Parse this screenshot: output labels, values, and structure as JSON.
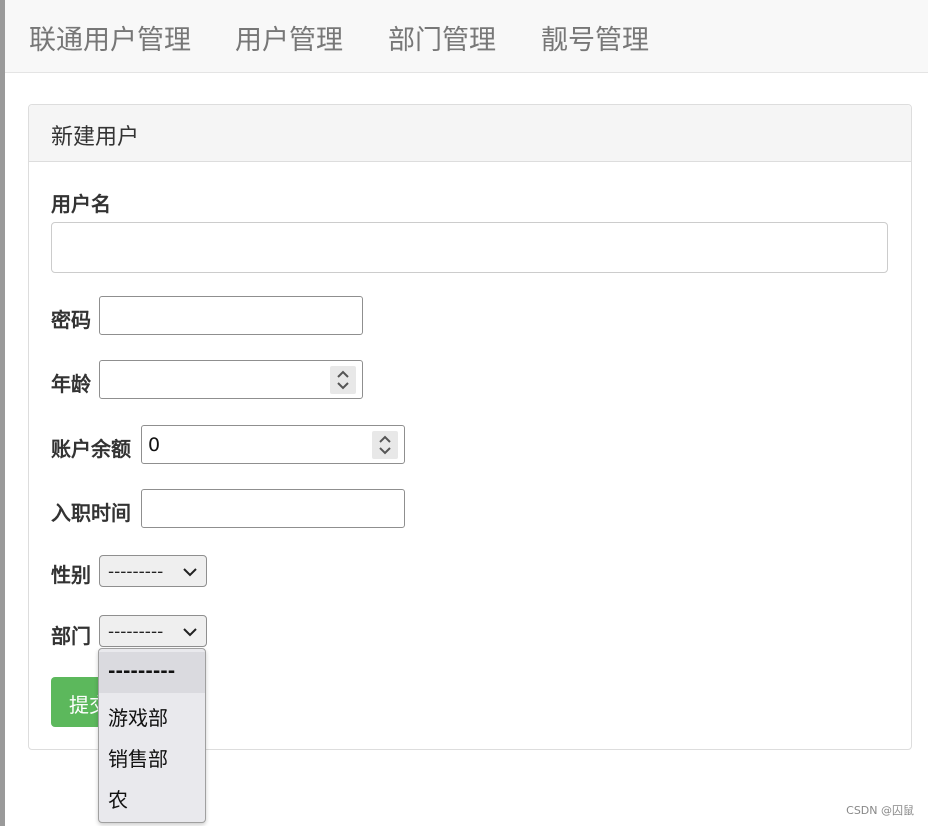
{
  "nav": {
    "items": [
      {
        "label": "联通用户管理"
      },
      {
        "label": "用户管理"
      },
      {
        "label": "部门管理"
      },
      {
        "label": "靓号管理"
      }
    ]
  },
  "panel": {
    "title": "新建用户"
  },
  "form": {
    "username": {
      "label": "用户名",
      "value": ""
    },
    "password": {
      "label": "密码",
      "value": ""
    },
    "age": {
      "label": "年龄",
      "value": ""
    },
    "balance": {
      "label": "账户余额",
      "value": "0"
    },
    "hire_date": {
      "label": "入职时间",
      "value": ""
    },
    "gender": {
      "label": "性别",
      "selected": "---------"
    },
    "department": {
      "label": "部门",
      "selected": "---------",
      "options": [
        "---------",
        "游戏部",
        "销售部",
        "农"
      ]
    },
    "submit_label": "提交"
  },
  "colors": {
    "submit": "#5cb85c",
    "navbar": "#f8f8f8",
    "panel_heading": "#f5f5f5"
  },
  "watermark": "CSDN @囚鼠"
}
